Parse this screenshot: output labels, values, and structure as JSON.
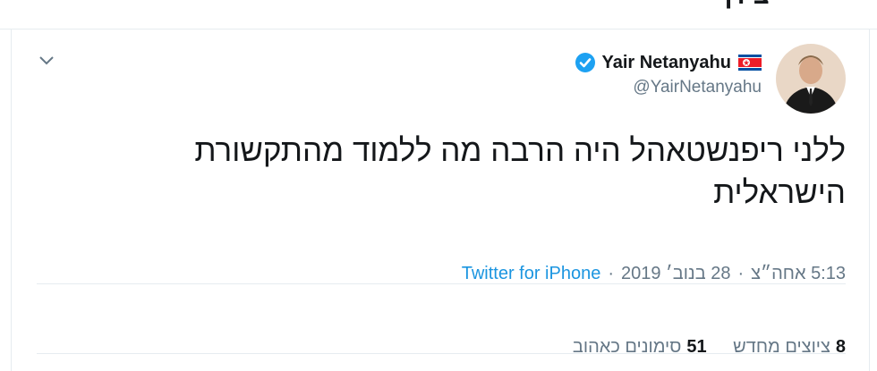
{
  "header": {
    "title": "ציוץ"
  },
  "tweet": {
    "author": {
      "display_name": "Yair Netanyahu",
      "handle": "@YairNetanyahu",
      "verified": true,
      "flag_icon": "north-korea-flag-icon"
    },
    "text_line1": "ללני ריפנשטאהל היה הרבה מה ללמוד מהתקשורת",
    "text_line2": "הישראלית",
    "time": "5:13 אחה״צ",
    "date": "28 בנוב׳ 2019",
    "source": "Twitter for iPhone",
    "separator": "·",
    "retweets": {
      "count": "8",
      "label": "ציוצים מחדש"
    },
    "likes": {
      "count": "51",
      "label": "סימונים כאהוב"
    }
  },
  "colors": {
    "link": "#1b95e0",
    "secondary_text": "#657786",
    "primary_text": "#14171a",
    "border": "#e6ecf0",
    "verified_badge": "#1da1f2"
  }
}
